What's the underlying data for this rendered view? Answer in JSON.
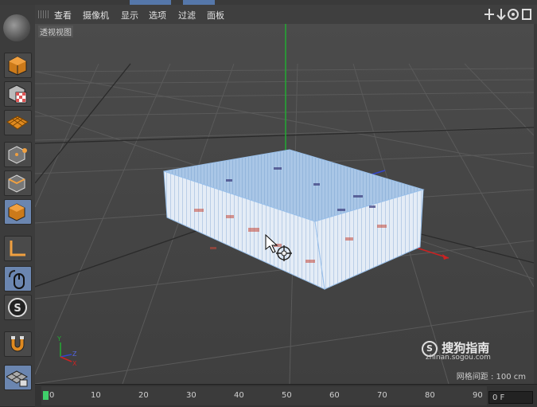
{
  "menu": {
    "items": [
      "查看",
      "摄像机",
      "显示",
      "选项",
      "过滤",
      "面板"
    ]
  },
  "viewport": {
    "label": "透视视图",
    "grid_spacing": "网格间距 : 100 cm",
    "axis_labels": {
      "y": "Y",
      "z": "Z",
      "x": "X"
    }
  },
  "watermark": {
    "brand": "搜狗指南",
    "site": "zhinan.sogou.com"
  },
  "timeline": {
    "ticks": [
      "0",
      "10",
      "20",
      "30",
      "40",
      "50",
      "60",
      "70",
      "80",
      "90"
    ],
    "current_frame": "0 F"
  },
  "toolbar": {
    "tools": [
      "model-mode-icon",
      "texture-mode-icon",
      "workplane-mode-icon",
      "points-mode-icon",
      "edges-mode-icon",
      "polygons-mode-icon",
      "axis-mode-icon",
      "tweak-mode-icon",
      "snap-icon",
      "magnet-icon",
      "grid-lock-icon"
    ]
  },
  "colors": {
    "viewport_bg": "#4a4a4a",
    "box_top": "#9fc1e6",
    "box_side": "#dfe8f4",
    "axis_red": "#cc2222",
    "axis_green": "#22aa33",
    "axis_blue": "#3344cc",
    "active_tool": "#6b86b0"
  }
}
